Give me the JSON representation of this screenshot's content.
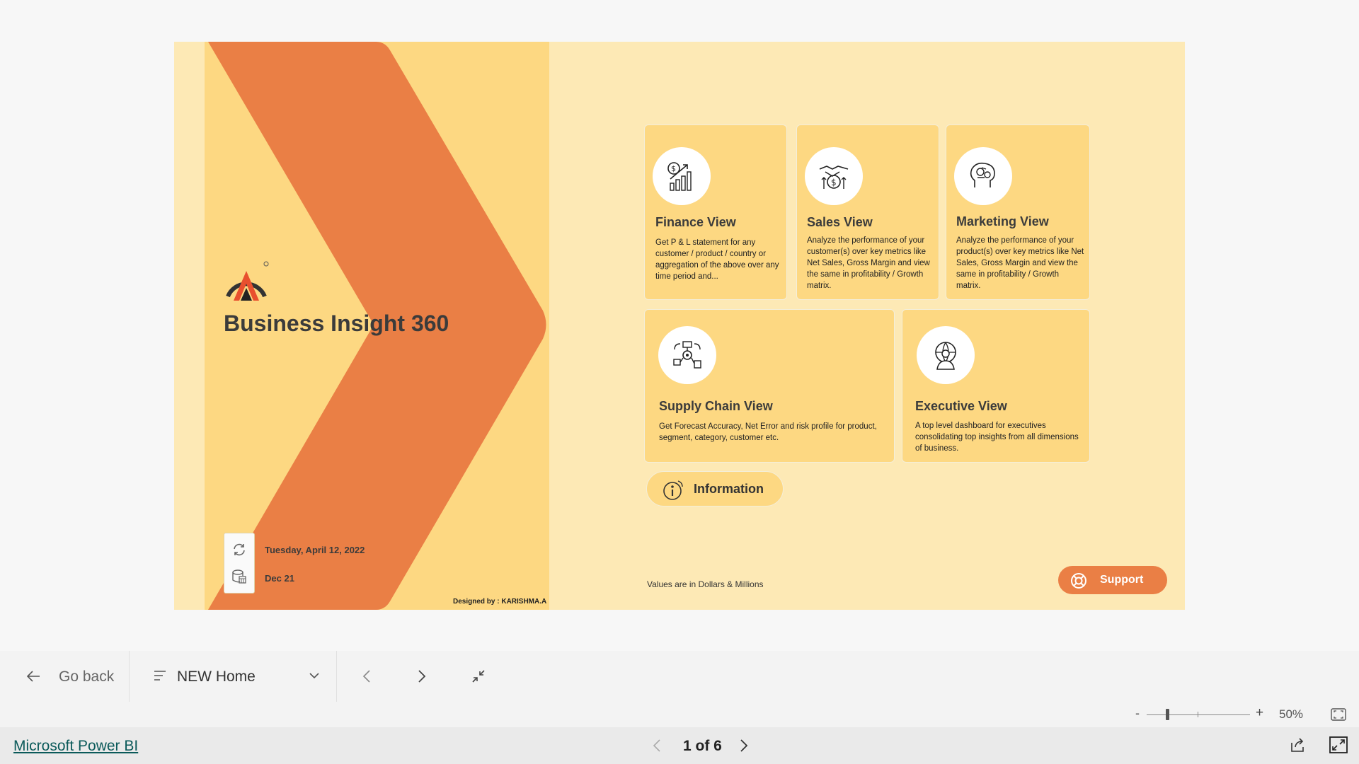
{
  "report": {
    "title": "Business Insight 360",
    "last_refresh_date": "Tuesday, April 12, 2022",
    "data_through": "Dec 21",
    "designer_credit": "Designed by : KARISHMA.A",
    "units_note": "Values are in Dollars & Millions",
    "colors": {
      "background": "#fde9b5",
      "panel": "#fdd882",
      "accent": "#ea7f45"
    }
  },
  "cards": [
    {
      "title": "Finance View",
      "icon": "finance-chart-icon",
      "description": "Get P & L statement for any customer / product / country or aggregation of the above over any time period and..."
    },
    {
      "title": "Sales View",
      "icon": "handshake-dollar-icon",
      "description": "Analyze the performance of your customer(s) over key metrics like Net Sales, Gross Margin and view the same in profitability / Growth matrix."
    },
    {
      "title": "Marketing View",
      "icon": "marketing-brain-icon",
      "description": "Analyze the performance of your product(s) over key metrics like Net Sales, Gross Margin and view the same in profitability / Growth matrix."
    },
    {
      "title": "Supply Chain View",
      "icon": "supply-chain-icon",
      "description": "Get Forecast Accuracy, Net Error and risk profile for product, segment, category, customer etc."
    },
    {
      "title": "Executive View",
      "icon": "executive-globe-icon",
      "description": "A top level dashboard for executives consolidating top insights from all dimensions of business."
    }
  ],
  "buttons": {
    "information": "Information",
    "support": "Support"
  },
  "navbar": {
    "go_back": "Go back",
    "page_name": "NEW Home"
  },
  "zoom": {
    "minus": "-",
    "plus": "+",
    "level": "50%",
    "slider_fraction": 0.2
  },
  "footer": {
    "brand_link": "Microsoft Power BI",
    "page_indicator": "1 of 6"
  }
}
